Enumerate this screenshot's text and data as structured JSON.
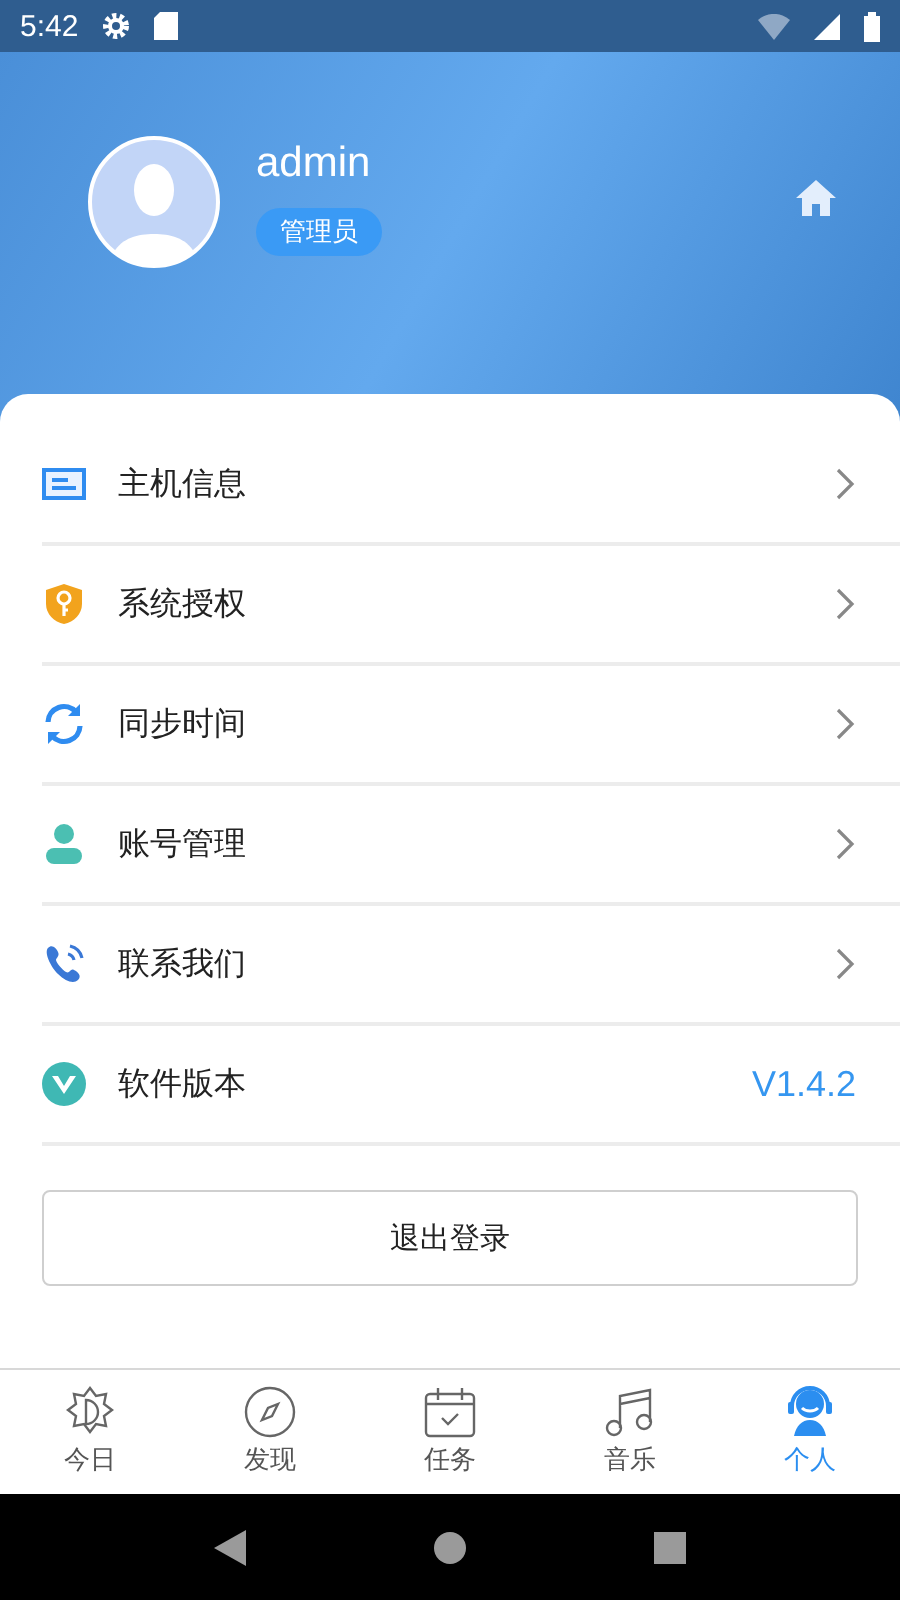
{
  "status_bar": {
    "time": "5:42"
  },
  "profile": {
    "username": "admin",
    "role": "管理员"
  },
  "menu": [
    {
      "label": "主机信息",
      "kind": "link"
    },
    {
      "label": "系统授权",
      "kind": "link"
    },
    {
      "label": "同步时间",
      "kind": "link"
    },
    {
      "label": "账号管理",
      "kind": "link"
    },
    {
      "label": "联系我们",
      "kind": "link"
    },
    {
      "label": "软件版本",
      "kind": "value",
      "value": "V1.4.2"
    }
  ],
  "logout_button": "退出登录",
  "tabs": [
    {
      "label": "今日",
      "selected": false
    },
    {
      "label": "发现",
      "selected": false
    },
    {
      "label": "任务",
      "selected": false
    },
    {
      "label": "音乐",
      "selected": false
    },
    {
      "label": "个人",
      "selected": true
    }
  ]
}
